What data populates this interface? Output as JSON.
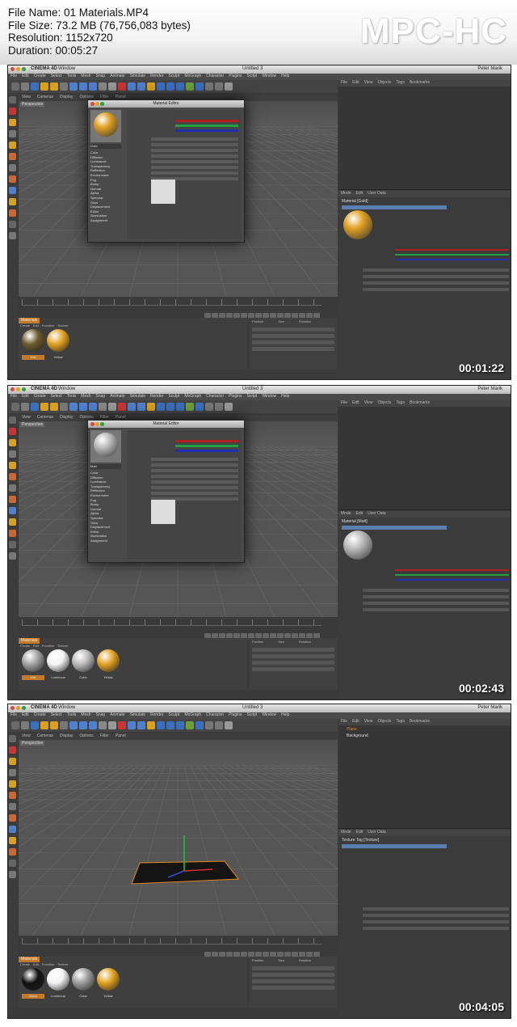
{
  "header": {
    "file_name_line": "File Name: 01 Materials.MP4",
    "file_size_line": "File Size: 73.2 MB (76,756,083 bytes)",
    "resolution_line": "Resolution: 1152x720",
    "duration_line": "Duration: 00:05:27",
    "logo": "MPC-HC"
  },
  "app": {
    "name": "CINEMA 4D",
    "window_menu": "Window",
    "document": "Untitled 3",
    "user": "Peter Marik",
    "menu": [
      "File",
      "Edit",
      "Create",
      "Select",
      "Tools",
      "Mesh",
      "Snap",
      "Animate",
      "Simulate",
      "Render",
      "Sculpt",
      "MoGraph",
      "Character",
      "Plugins",
      "Script",
      "Window",
      "Help"
    ],
    "viewport_menu": [
      "View",
      "Cameras",
      "Display",
      "Options",
      "Filter",
      "Panel"
    ],
    "viewport_label": "Perspective",
    "object_manager_menu": [
      "File",
      "Edit",
      "View",
      "Objects",
      "Tags",
      "Bookmarks"
    ],
    "attr_menu": [
      "Mode",
      "Edit",
      "User Data"
    ],
    "material_manager_menu": [
      "Create",
      "Edit",
      "Function",
      "Texture"
    ],
    "material_tab": "Materials",
    "coords_headers": [
      "Position",
      "Size",
      "Rotation"
    ]
  },
  "frames": [
    {
      "timecode": "00:01:22",
      "dialog_title": "Material Editor",
      "material_name": "Gold",
      "dialog_channels": [
        "Color",
        "Diffusion",
        "Luminance",
        "Transparency",
        "Reflection",
        "Environment",
        "Fog",
        "Bump",
        "Normal",
        "Alpha",
        "Specular",
        "Glow",
        "Displacement",
        "Editor",
        "Illumination",
        "Assignment"
      ],
      "attr_title": "Material [Gold]",
      "swatches": [
        {
          "label": "Mat",
          "color": "#6b5a2a"
        },
        {
          "label": "Yellow",
          "color": "#e0a020"
        }
      ],
      "ball_color": "#e0a020"
    },
    {
      "timecode": "00:02:43",
      "dialog_title": "Material Editor",
      "material_name": "Matt",
      "dialog_channels": [
        "Color",
        "Diffusion",
        "Luminance",
        "Transparency",
        "Reflection",
        "Environment",
        "Fog",
        "Bump",
        "Normal",
        "Alpha",
        "Specular",
        "Glow",
        "Displacement",
        "Editor",
        "Illumination",
        "Assignment"
      ],
      "attr_title": "Material [Matt]",
      "swatches": [
        {
          "label": "Mat",
          "color": "#a0a0a0"
        },
        {
          "label": "Luminous",
          "color": "#f2f2f2"
        },
        {
          "label": "Color",
          "color": "#b8b8b8"
        },
        {
          "label": "Yellow",
          "color": "#e0a020"
        }
      ],
      "ball_color": "#bbbbbb"
    },
    {
      "timecode": "00:04:05",
      "dialog_title": "",
      "material_name": "",
      "dialog_channels": [],
      "attr_title": "Texture Tag [Texture]",
      "objects": [
        "Plane",
        "Background"
      ],
      "swatches": [
        {
          "label": "Black",
          "color": "#111111"
        },
        {
          "label": "Luminous",
          "color": "#f2f2f2"
        },
        {
          "label": "Color",
          "color": "#9a9a9a"
        },
        {
          "label": "Yellow",
          "color": "#e0a020"
        }
      ],
      "ball_color": ""
    }
  ],
  "colors": {
    "accent_orange": "#c37a2a",
    "slider_red": "#b02020",
    "slider_green": "#20a040",
    "slider_blue": "#2030b0",
    "attr_tab_blue": "#5a7fae"
  }
}
